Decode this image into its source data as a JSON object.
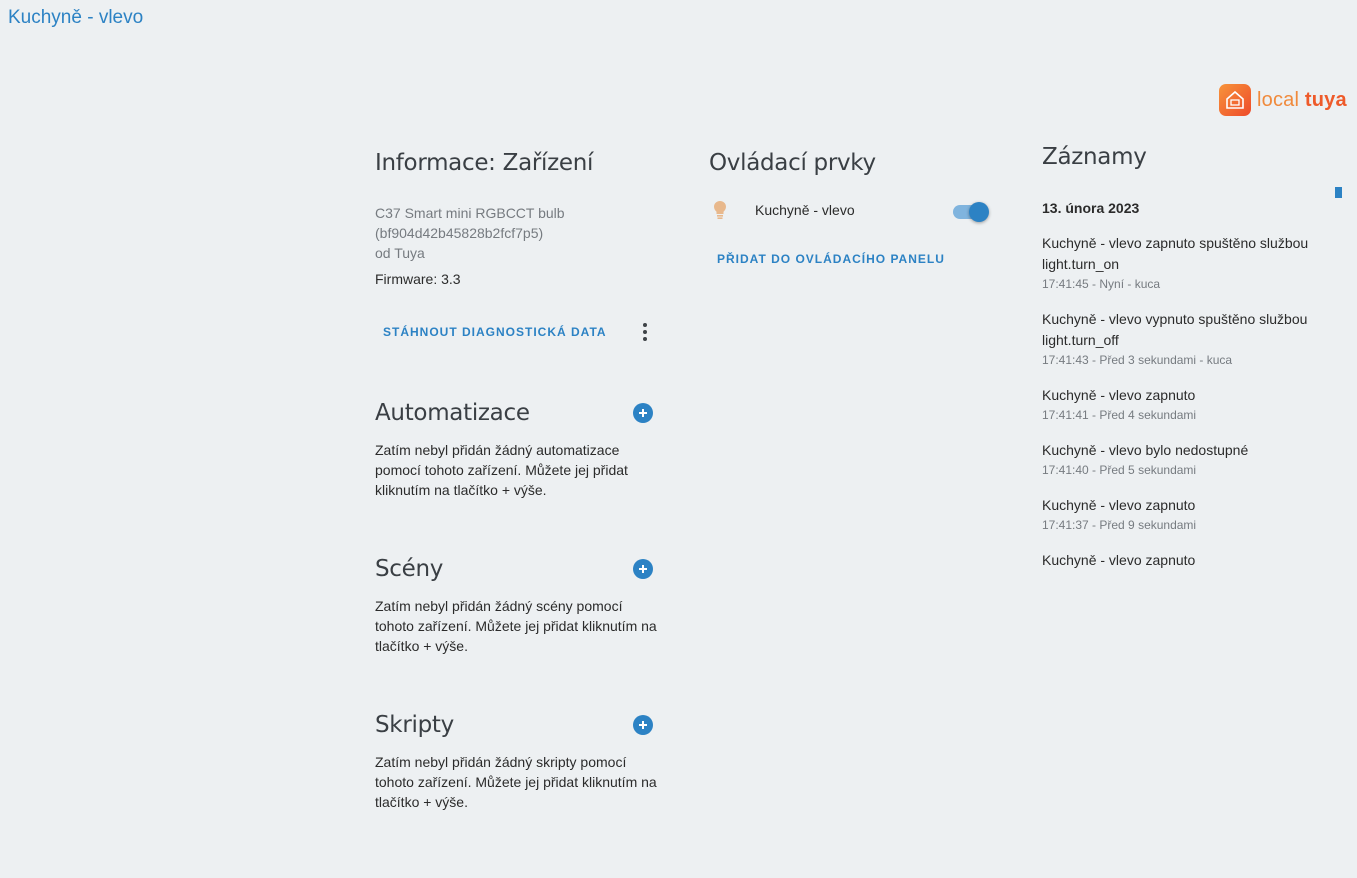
{
  "header": {
    "title": "Kuchyně - vlevo"
  },
  "brand": {
    "word_local": "local",
    "word_tuya": "tuya",
    "icon": "home-icon"
  },
  "device_info": {
    "heading": "Informace: Zařízení",
    "model": "C37 Smart mini RGBCCT bulb",
    "id": "(bf904d42b45828b2fcf7p5)",
    "vendor": "od Tuya",
    "firmware": "Firmware: 3.3",
    "download_label": "STÁHNOUT DIAGNOSTICKÁ DATA"
  },
  "automations": {
    "heading": "Automatizace",
    "empty_text": "Zatím nebyl přidán žádný automatizace pomocí tohoto zařízení. Můžete jej přidat kliknutím na tlačítko + výše."
  },
  "scenes": {
    "heading": "Scény",
    "empty_text": "Zatím nebyl přidán žádný scény pomocí tohoto zařízení. Můžete jej přidat kliknutím na tlačítko + výše."
  },
  "scripts": {
    "heading": "Skripty",
    "empty_text": "Zatím nebyl přidán žádný skripty pomocí tohoto zařízení. Můžete jej přidat kliknutím na tlačítko + výše."
  },
  "controls": {
    "heading": "Ovládací prvky",
    "entity_name": "Kuchyně - vlevo",
    "entity_icon": "lightbulb-icon",
    "toggle_state": "on",
    "add_to_dashboard_label": "PŘIDAT DO OVLÁDACÍHO PANELU"
  },
  "logbook": {
    "heading": "Záznamy",
    "date": "13. února 2023",
    "entries": [
      {
        "msg": "Kuchyně - vlevo zapnuto spuštěno službou light.turn_on",
        "meta": "17:41:45 - Nyní - kuca"
      },
      {
        "msg": "Kuchyně - vlevo vypnuto spuštěno službou light.turn_off",
        "meta": "17:41:43 - Před 3 sekundami - kuca"
      },
      {
        "msg": "Kuchyně - vlevo zapnuto",
        "meta": "17:41:41 - Před 4 sekundami"
      },
      {
        "msg": "Kuchyně - vlevo bylo nedostupné",
        "meta": "17:41:40 - Před 5 sekundami"
      },
      {
        "msg": "Kuchyně - vlevo zapnuto",
        "meta": "17:41:37 - Před 9 sekundami"
      },
      {
        "msg": "Kuchyně - vlevo zapnuto",
        "meta": ""
      }
    ]
  },
  "colors": {
    "accent": "#2c82c4",
    "background": "#edf0f2",
    "bulb": "#e8b88c"
  }
}
